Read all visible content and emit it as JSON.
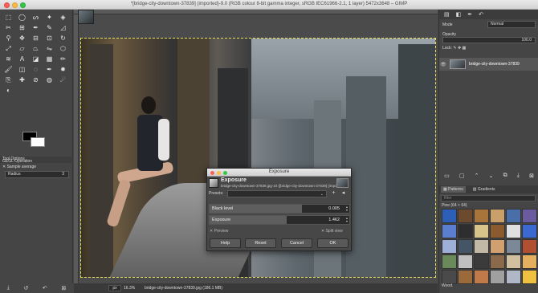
{
  "window": {
    "title": "*[bridge-city-downtown-37839] (imported)-9.0 (RGB colour 8-bit gamma integer, sRGB IEC61966-2.1, 1 layer) 5472x3648 – GIMP"
  },
  "toolbox": {
    "tool_icons": [
      "rect-select-icon",
      "ellipse-select-icon",
      "free-select-icon",
      "fuzzy-select-icon",
      "by-color-select-icon",
      "scissors-select-icon",
      "foreground-select-icon",
      "paths-icon",
      "color-picker-icon",
      "measure-icon",
      "zoom-icon",
      "move-icon",
      "align-icon",
      "crop-icon",
      "rotate-icon",
      "scale-icon",
      "shear-icon",
      "perspective-icon",
      "flip-icon",
      "cage-icon",
      "warp-icon",
      "text-icon",
      "bucket-fill-icon",
      "gradient-icon",
      "pencil-icon",
      "paintbrush-icon",
      "eraser-icon",
      "airbrush-icon",
      "ink-icon",
      "mypaint-brush-icon",
      "clone-icon",
      "heal-icon",
      "perspective-clone-icon",
      "blur-icon",
      "smudge-icon",
      "dodge-icon"
    ],
    "tool_glyphs": [
      "⬚",
      "◯",
      "ᔕ",
      "✦",
      "◈",
      "✂",
      "⊞",
      "✒",
      "✎",
      "◿",
      "⚲",
      "✥",
      "⊟",
      "⊡",
      "↻",
      "⤢",
      "▱",
      "⏢",
      "⇋",
      "⬡",
      "≋",
      "A",
      "◪",
      "▦",
      "✏",
      "🖌",
      "◫",
      "◌",
      "✒",
      "✸",
      "⎘",
      "✚",
      "⊘",
      "◍",
      "☄",
      "◐"
    ],
    "options_header": "Tool Options",
    "operation_label": "GEGL Operation",
    "sample_average": "Sample average",
    "radius_label": "Radius",
    "radius_value": "3",
    "bottom_icons": [
      "save-icon",
      "restore-icon",
      "reset-icon",
      "delete-icon"
    ],
    "bottom_glyphs": [
      "⤓",
      "↺",
      "↶",
      "⊠"
    ]
  },
  "canvas": {
    "unit": "px",
    "zoom": "16.3%",
    "status": "bridge-city-downtown-37839.jpg (186.1 MB)"
  },
  "dock": {
    "mode_label": "Mode",
    "mode_value": "Normal",
    "opacity_label": "Opacity",
    "opacity_value": "100.0",
    "lock_label": "Lock:",
    "layer_name": "bridge-city-downtown-37839",
    "layer_buttons": [
      "▭",
      "▢",
      "⌃",
      "⌄",
      "⧉",
      "⤓",
      "⊠"
    ],
    "patterns_tab": "Patterns",
    "gradients_tab": "Gradients",
    "filter_placeholder": "filter",
    "pattern_size": "Pine (64 × 64)",
    "pattern_name": "Wood.",
    "swatch_colors": [
      "#2e5fb8",
      "#6b4a2e",
      "#a8743a",
      "#c9a06a",
      "#4a6fa8",
      "#6a5aa0",
      "#5a7fd0",
      "#2e2e2e",
      "#d7c48a",
      "#8b5a2e",
      "#e0e0e0",
      "#3a6ad0",
      "#9fb0d8",
      "#445566",
      "#c2b8a6",
      "#d0a070",
      "#7a8898",
      "#b05030",
      "#6a8a5a",
      "#c0c0c0",
      "#3b3b3b",
      "#8a6a4a",
      "#d0c0a0",
      "#e4b060",
      "#4a4a4a",
      "#9a6a3a",
      "#c07a4a",
      "#a0a0a0",
      "#b0b8c8",
      "#f0c040"
    ]
  },
  "dialog": {
    "title": "Exposure",
    "heading": "Exposure",
    "subheading": "bridge-city-downtown-37839.jpg-10 ([bridge-city-downtown-37839] (imported))",
    "presets_label": "Presets:",
    "black_level_label": "Black level",
    "black_level_value": "0.005",
    "black_level_fraction": 0.66,
    "exposure_label": "Exposure",
    "exposure_value": "1.462",
    "exposure_fraction": 0.55,
    "preview_label": "Preview",
    "split_view_label": "Split view",
    "buttons": {
      "help": "Help",
      "reset": "Reset",
      "cancel": "Cancel",
      "ok": "OK"
    }
  }
}
